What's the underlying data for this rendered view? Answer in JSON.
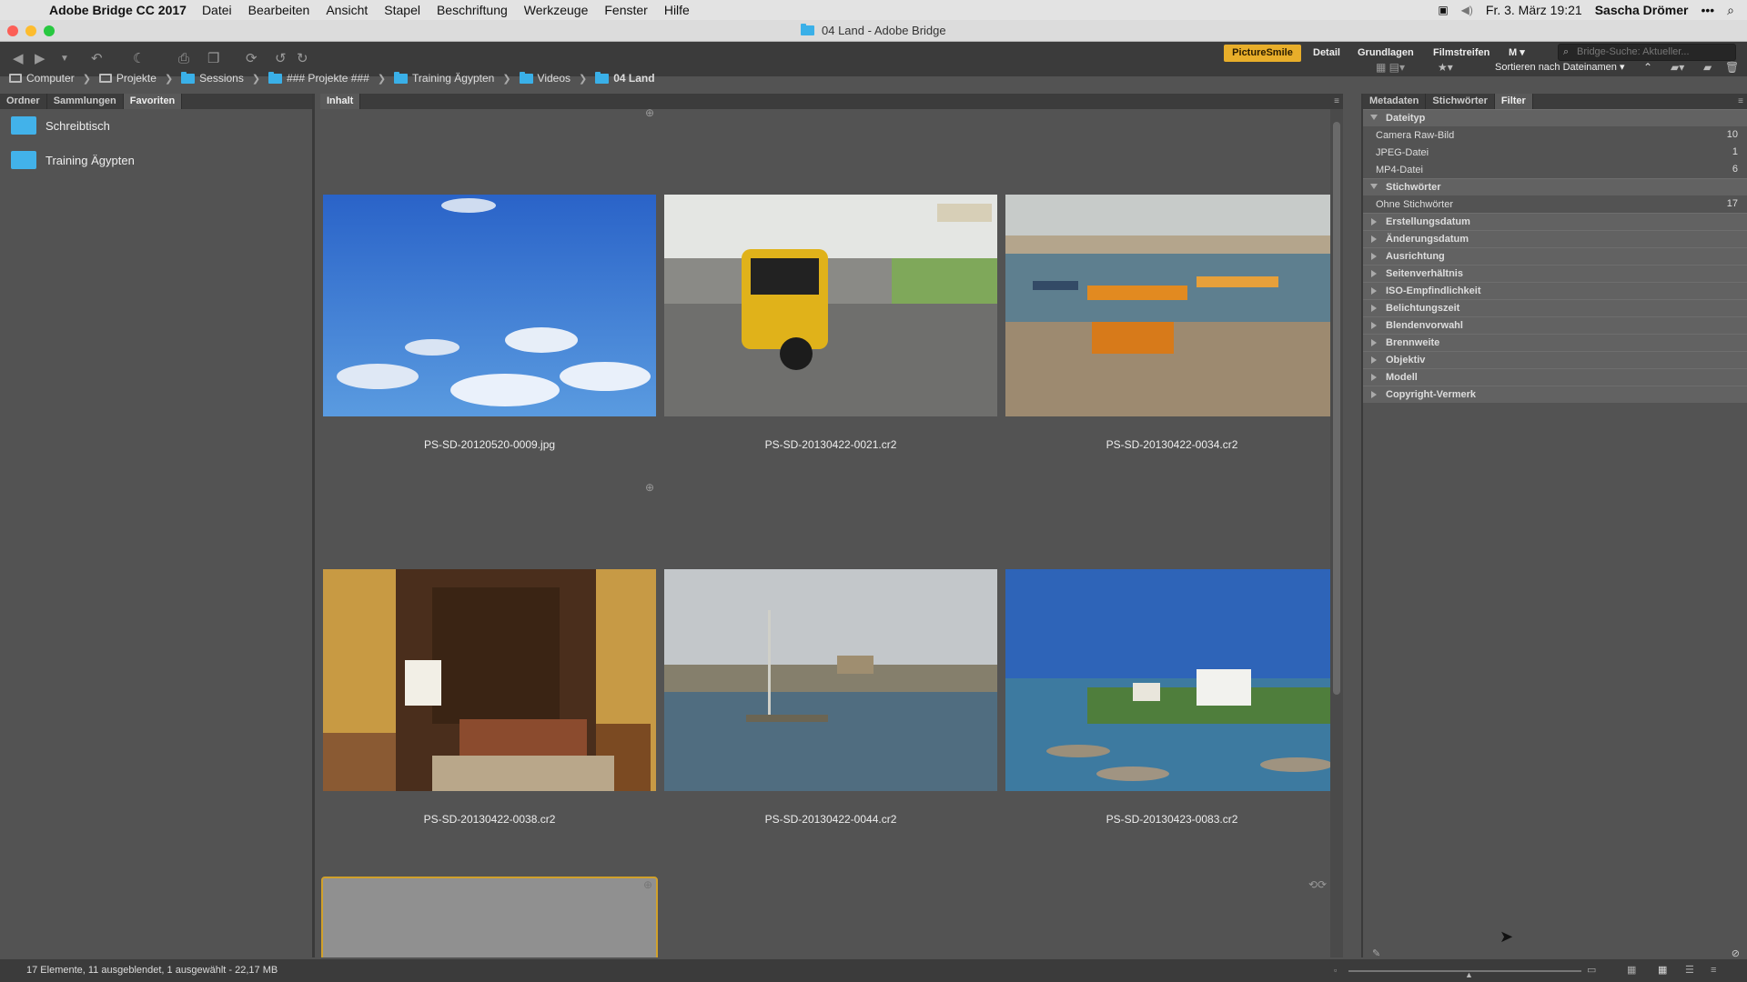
{
  "menubar": {
    "app_name": "Adobe Bridge CC 2017",
    "items": [
      "Datei",
      "Bearbeiten",
      "Ansicht",
      "Stapel",
      "Beschriftung",
      "Werkzeuge",
      "Fenster",
      "Hilfe"
    ],
    "datetime": "Fr. 3. März 19:21",
    "user": "Sascha Drömer"
  },
  "window": {
    "title": "04 Land - Adobe Bridge"
  },
  "toolbar": {
    "workspaces": [
      "PictureSmile",
      "Detail",
      "Grundlagen",
      "Filmstreifen"
    ],
    "more_label": "M",
    "search_placeholder": "Bridge-Suche: Aktueller...",
    "sort_label": "Sortieren nach Dateinamen"
  },
  "breadcrumb": [
    "Computer",
    "Projekte",
    "Sessions",
    "### Projekte ###",
    "Training Ägypten",
    "Videos",
    "04 Land"
  ],
  "left_panel": {
    "tabs": [
      "Ordner",
      "Sammlungen",
      "Favoriten"
    ],
    "favorites": [
      "Schreibtisch",
      "Training Ägypten"
    ]
  },
  "content": {
    "tab": "Inhalt",
    "files": [
      "PS-SD-20120520-0009.jpg",
      "PS-SD-20130422-0021.cr2",
      "PS-SD-20130422-0034.cr2",
      "PS-SD-20130422-0038.cr2",
      "PS-SD-20130422-0044.cr2",
      "PS-SD-20130423-0083.cr2"
    ]
  },
  "right_panel": {
    "tabs": [
      "Metadaten",
      "Stichwörter",
      "Filter"
    ],
    "groups": [
      {
        "title": "Dateityp",
        "items": [
          {
            "label": "Camera Raw-Bild",
            "count": "10"
          },
          {
            "label": "JPEG-Datei",
            "count": "1"
          },
          {
            "label": "MP4-Datei",
            "count": "6"
          }
        ]
      },
      {
        "title": "Stichwörter",
        "items": [
          {
            "label": "Ohne Stichwörter",
            "count": "17"
          }
        ]
      },
      {
        "title": "Erstellungsdatum",
        "items": []
      },
      {
        "title": "Änderungsdatum",
        "items": []
      },
      {
        "title": "Ausrichtung",
        "items": []
      },
      {
        "title": "Seitenverhältnis",
        "items": []
      },
      {
        "title": "ISO-Empfindlichkeit",
        "items": []
      },
      {
        "title": "Belichtungszeit",
        "items": []
      },
      {
        "title": "Blendenvorwahl",
        "items": []
      },
      {
        "title": "Brennweite",
        "items": []
      },
      {
        "title": "Objektiv",
        "items": []
      },
      {
        "title": "Modell",
        "items": []
      },
      {
        "title": "Copyright-Vermerk",
        "items": []
      }
    ]
  },
  "statusbar": {
    "text": "17 Elemente, 11 ausgeblendet, 1 ausgewählt - 22,17 MB"
  }
}
